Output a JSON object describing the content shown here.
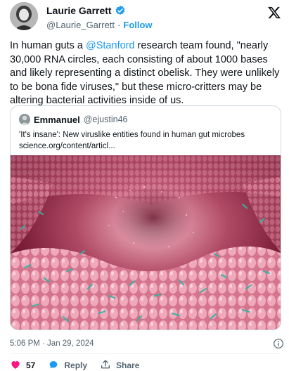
{
  "author": {
    "display_name": "Laurie Garrett",
    "handle": "@Laurie_Garrett",
    "follow_label": "Follow",
    "separator": "·"
  },
  "tweet": {
    "text_before": "In human guts a ",
    "mention": "@Stanford",
    "text_after": " research team found, \"nearly 30,000 RNA circles, each consisting of about 1000 bases and likely representing a distinct obelisk. They were unlikely to be bona fide viruses,\" but these micro-critters may be altering bacterial activities  inside of us."
  },
  "quote": {
    "display_name": "Emmanuel",
    "handle": "@ejustin46",
    "text": "'It's insane': New viruslike entities found in human gut microbes",
    "link": "science.org/content/articl..."
  },
  "meta": {
    "timestamp": "5:06 PM · Jan 29, 2024"
  },
  "actions": {
    "like_count": "57",
    "reply_label": "Reply",
    "share_label": "Share"
  },
  "colors": {
    "accent": "#1d9bf0",
    "like": "#f91880",
    "muted": "#536471"
  }
}
